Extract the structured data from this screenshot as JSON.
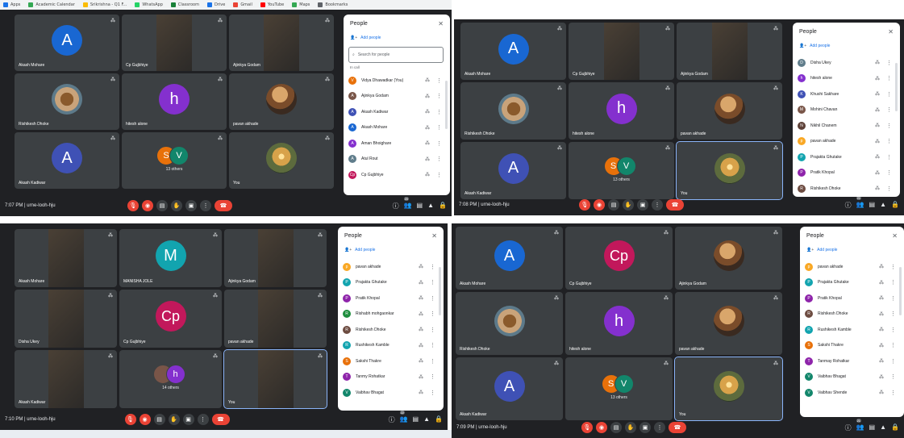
{
  "bookmarks": [
    "Apps",
    "Academic Calendar",
    "Srikrishna - Q1 F...",
    "WhatsApp",
    "Classroom",
    "Drive",
    "Gmail",
    "YouTube",
    "Maps",
    "Bookmarks"
  ],
  "quadrants": [
    {
      "time": "7:07 PM",
      "code": "urne-looh-hju",
      "badge": "20",
      "tiles": [
        {
          "name": "Akash Mohare",
          "type": "avatar",
          "letter": "A",
          "color": "#1967d2"
        },
        {
          "name": "Cp Gujbhiye",
          "type": "video"
        },
        {
          "name": "Ajinkya Godam",
          "type": "video"
        },
        {
          "name": "Rishikesh Dhoke",
          "type": "photo",
          "img": "bird"
        },
        {
          "name": "hitesh alone",
          "type": "avatar",
          "letter": "h",
          "color": "#8430ce"
        },
        {
          "name": "pavan akhade",
          "type": "photo"
        },
        {
          "name": "Akash Kadiwar",
          "type": "avatar",
          "letter": "A",
          "color": "#3f51b5"
        },
        {
          "name": "",
          "type": "others",
          "letters": [
            "S",
            "V"
          ],
          "colors": [
            "#e8710a",
            "#12866b"
          ],
          "caption": "13 others"
        },
        {
          "name": "You",
          "type": "photo",
          "img": "sun"
        }
      ],
      "panel": {
        "title": "People",
        "add": "Add people",
        "search": "Search for people",
        "incall": "In call",
        "rows": [
          {
            "name": "Vidya Dhawadkar (You)",
            "color": "#e8710a",
            "letter": "V"
          },
          {
            "name": "Ajinkya Godam",
            "color": "#795548",
            "letter": "A"
          },
          {
            "name": "Akash Kadiwar",
            "color": "#3f51b5",
            "letter": "A"
          },
          {
            "name": "Akash Mohare",
            "color": "#1967d2",
            "letter": "A"
          },
          {
            "name": "Aman Bhoighare",
            "color": "#8430ce",
            "letter": "A"
          },
          {
            "name": "Atul Rout",
            "color": "#607d8b",
            "letter": "A"
          },
          {
            "name": "Cp Gujbhiye",
            "color": "#c2185b",
            "letter": "Cp"
          }
        ]
      }
    },
    {
      "time": "7:08 PM",
      "code": "urne-looh-hju",
      "badge": "21",
      "tiles": [
        {
          "name": "Akash Mohare",
          "type": "avatar",
          "letter": "A",
          "color": "#1967d2"
        },
        {
          "name": "Cp Gujbhiye",
          "type": "video"
        },
        {
          "name": "Ajinkya Godam",
          "type": "video"
        },
        {
          "name": "Rishikesh Dhoke",
          "type": "photo",
          "img": "bird"
        },
        {
          "name": "hitesh alone",
          "type": "avatar",
          "letter": "h",
          "color": "#8430ce"
        },
        {
          "name": "pavan akhade",
          "type": "photo"
        },
        {
          "name": "Akash Kadiwar",
          "type": "avatar",
          "letter": "A",
          "color": "#3f51b5"
        },
        {
          "name": "",
          "type": "others",
          "letters": [
            "S",
            "V"
          ],
          "colors": [
            "#e8710a",
            "#12866b"
          ],
          "caption": "13 others"
        },
        {
          "name": "You",
          "type": "photo",
          "img": "sun",
          "sel": true
        }
      ],
      "panel": {
        "title": "People",
        "add": "Add people",
        "rows": [
          {
            "name": "Disha Ukey",
            "color": "#607d8b",
            "letter": "D"
          },
          {
            "name": "hitesh alone",
            "color": "#8430ce",
            "letter": "h"
          },
          {
            "name": "Khushi Sakhare",
            "color": "#3f51b5",
            "letter": "K"
          },
          {
            "name": "Mohini Chavan",
            "color": "#795548",
            "letter": "M"
          },
          {
            "name": "Nikhil Chanem",
            "color": "#5d4037",
            "letter": "N"
          },
          {
            "name": "pavan akhade",
            "color": "#f9a825",
            "letter": "p"
          },
          {
            "name": "Prajakta Ghutake",
            "color": "#12a4af",
            "letter": "P"
          },
          {
            "name": "Pratik Khopal",
            "color": "#8e24aa",
            "letter": "P"
          },
          {
            "name": "Rishikesh Dhoke",
            "color": "#6d4c41",
            "letter": "R"
          }
        ]
      }
    },
    {
      "time": "7:10 PM",
      "code": "urne-looh-hju",
      "badge": "22",
      "tiles": [
        {
          "name": "Akash Mohare",
          "type": "video"
        },
        {
          "name": "MANISHA JOLE",
          "type": "avatar",
          "letter": "M",
          "color": "#12a4af"
        },
        {
          "name": "Ajinkya Godam",
          "type": "video"
        },
        {
          "name": "Disha Ukey",
          "type": "video"
        },
        {
          "name": "Cp Gujbhiye",
          "type": "avatar",
          "letter": "Cp",
          "color": "#c2185b"
        },
        {
          "name": "pavan akhade",
          "type": "video"
        },
        {
          "name": "Akash Kadiwar",
          "type": "video"
        },
        {
          "name": "",
          "type": "others",
          "letters": [
            "",
            "h"
          ],
          "colors": [
            "#795548",
            "#8430ce"
          ],
          "caption": "14 others"
        },
        {
          "name": "You",
          "type": "video",
          "sel": true
        }
      ],
      "panel": {
        "title": "People",
        "add": "Add people",
        "rows": [
          {
            "name": "pavan akhade",
            "color": "#f9a825",
            "letter": "p"
          },
          {
            "name": "Prajakta Ghutake",
            "color": "#12a4af",
            "letter": "P"
          },
          {
            "name": "Pratik Khopal",
            "color": "#8e24aa",
            "letter": "P"
          },
          {
            "name": "Rishabh mohgaonkar",
            "color": "#1e8e3e",
            "letter": "R"
          },
          {
            "name": "Rishikesh Dhoke",
            "color": "#6d4c41",
            "letter": "R"
          },
          {
            "name": "Rushikesh Kamble",
            "color": "#12a4af",
            "letter": "R"
          },
          {
            "name": "Sakshi Thakre",
            "color": "#e8710a",
            "letter": "S"
          },
          {
            "name": "Tanmy Rohatkar",
            "color": "#8e24aa",
            "letter": "T"
          },
          {
            "name": "Vaibhav Bhagat",
            "color": "#12866b",
            "letter": "V"
          }
        ]
      }
    },
    {
      "time": "7:09 PM",
      "code": "urne-looh-hju",
      "badge": "21",
      "tiles": [
        {
          "name": "Akash Mohare",
          "type": "avatar",
          "letter": "A",
          "color": "#1967d2"
        },
        {
          "name": "Cp Gujbhiye",
          "type": "avatar",
          "letter": "Cp",
          "color": "#c2185b"
        },
        {
          "name": "Ajinkya Godam",
          "type": "photo"
        },
        {
          "name": "Rishikesh Dhoke",
          "type": "photo",
          "img": "bird"
        },
        {
          "name": "hitesh alone",
          "type": "avatar",
          "letter": "h",
          "color": "#8430ce"
        },
        {
          "name": "pavan akhade",
          "type": "photo"
        },
        {
          "name": "Akash Kadiwar",
          "type": "avatar",
          "letter": "A",
          "color": "#3f51b5"
        },
        {
          "name": "",
          "type": "others",
          "letters": [
            "S",
            "V"
          ],
          "colors": [
            "#e8710a",
            "#12866b"
          ],
          "caption": "13 others"
        },
        {
          "name": "You",
          "type": "photo",
          "img": "sun",
          "sel": true
        }
      ],
      "panel": {
        "title": "People",
        "add": "Add people",
        "rows": [
          {
            "name": "pavan akhade",
            "color": "#f9a825",
            "letter": "p"
          },
          {
            "name": "Prajakta Ghutake",
            "color": "#12a4af",
            "letter": "P"
          },
          {
            "name": "Pratik Khopal",
            "color": "#8e24aa",
            "letter": "P"
          },
          {
            "name": "Rishikesh Dhoke",
            "color": "#6d4c41",
            "letter": "R"
          },
          {
            "name": "Rushikesh Kamble",
            "color": "#12a4af",
            "letter": "R"
          },
          {
            "name": "Sakshi Thakre",
            "color": "#e8710a",
            "letter": "S"
          },
          {
            "name": "Tanmay Rohatkar",
            "color": "#8e24aa",
            "letter": "T"
          },
          {
            "name": "Vaibhav Bhagat",
            "color": "#12866b",
            "letter": "V"
          },
          {
            "name": "Vaibhav Shende",
            "color": "#12866b",
            "letter": "V"
          }
        ]
      }
    }
  ]
}
